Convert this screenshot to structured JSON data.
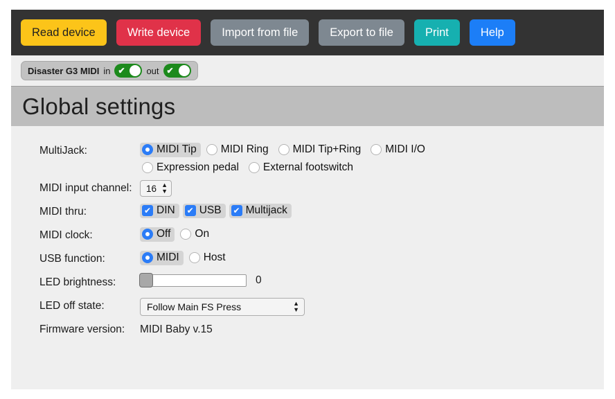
{
  "toolbar": {
    "buttons": [
      {
        "label": "Read device",
        "name": "read-device-button"
      },
      {
        "label": "Write device",
        "name": "write-device-button"
      },
      {
        "label": "Import from file",
        "name": "import-from-file-button"
      },
      {
        "label": "Export to file",
        "name": "export-to-file-button"
      },
      {
        "label": "Print",
        "name": "print-button"
      },
      {
        "label": "Help",
        "name": "help-button"
      }
    ],
    "colors": {
      "read": "#fcc419",
      "write": "#e03249",
      "import": "#7e8891",
      "export": "#7e8891",
      "print": "#16b0b0",
      "help": "#1c7ef7",
      "background": "#333333"
    }
  },
  "status": {
    "device_name": "Disaster G3 MIDI",
    "in_label": "in",
    "out_label": "out",
    "in_state": "on",
    "out_state": "on",
    "check_glyph": "✔",
    "toggle_on_color": "#1c8a1c"
  },
  "heading": {
    "title": "Global settings",
    "background": "#bdbdbd"
  },
  "form": {
    "multijack": {
      "label": "MultiJack:",
      "options_row1": [
        {
          "label": "MIDI Tip",
          "selected": true
        },
        {
          "label": "MIDI Ring",
          "selected": false
        },
        {
          "label": "MIDI Tip+Ring",
          "selected": false
        },
        {
          "label": "MIDI I/O",
          "selected": false
        }
      ],
      "options_row2": [
        {
          "label": "Expression pedal",
          "selected": false
        },
        {
          "label": "External footswitch",
          "selected": false
        }
      ]
    },
    "midi_input_channel": {
      "label": "MIDI input channel:",
      "value": "16"
    },
    "midi_thru": {
      "label": "MIDI thru:",
      "options": [
        {
          "label": "DIN",
          "checked": true
        },
        {
          "label": "USB",
          "checked": true
        },
        {
          "label": "Multijack",
          "checked": true
        }
      ]
    },
    "midi_clock": {
      "label": "MIDI clock:",
      "options": [
        {
          "label": "Off",
          "selected": true
        },
        {
          "label": "On",
          "selected": false
        }
      ]
    },
    "usb_function": {
      "label": "USB function:",
      "options": [
        {
          "label": "MIDI",
          "selected": true
        },
        {
          "label": "Host",
          "selected": false
        }
      ]
    },
    "led_brightness": {
      "label": "LED brightness:",
      "value": "0",
      "percent": 0
    },
    "led_off_state": {
      "label": "LED off state:",
      "value": "Follow Main FS Press"
    },
    "firmware_version": {
      "label": "Firmware version:",
      "value": "MIDI Baby v.15"
    }
  },
  "icons": {
    "up_arrow": "▲",
    "down_arrow": "▼",
    "check": "✔"
  }
}
